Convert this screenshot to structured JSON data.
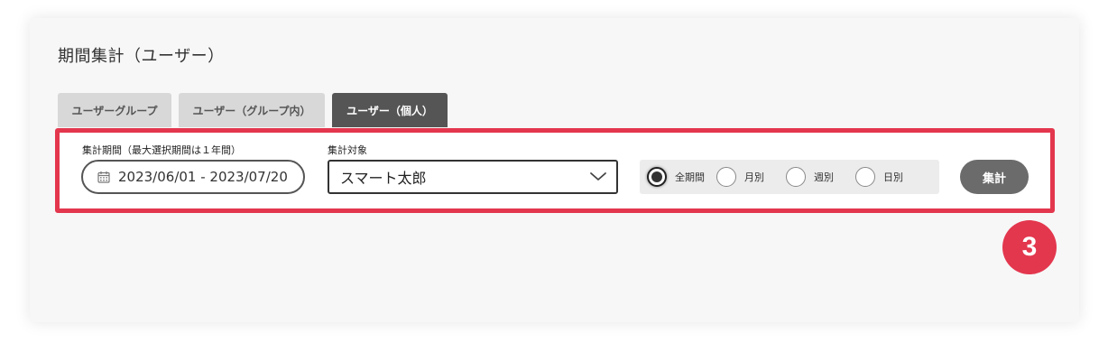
{
  "page": {
    "title": "期間集計（ユーザー）"
  },
  "tabs": [
    {
      "label": "ユーザーグループ",
      "active": false
    },
    {
      "label": "ユーザー（グループ内）",
      "active": false
    },
    {
      "label": "ユーザー（個人）",
      "active": true
    }
  ],
  "filter": {
    "period_label": "集計期間（最大選択期間は１年間）",
    "date_range": "2023/06/01 - 2023/07/20",
    "date_icon": "calendar-icon",
    "target_label": "集計対象",
    "target_value": "スマート太郎",
    "select_icon": "chevron-down-icon",
    "granularity": {
      "selected": "全期間",
      "options": [
        "全期間",
        "月別",
        "週別",
        "日別"
      ]
    },
    "submit_label": "集計"
  },
  "annotation": {
    "step_number": "3",
    "color": "#e3374e"
  },
  "colors": {
    "active_tab": "#555555",
    "inactive_tab": "#d8d8d8",
    "button": "#6b6b6b",
    "highlight": "#e3374e"
  }
}
